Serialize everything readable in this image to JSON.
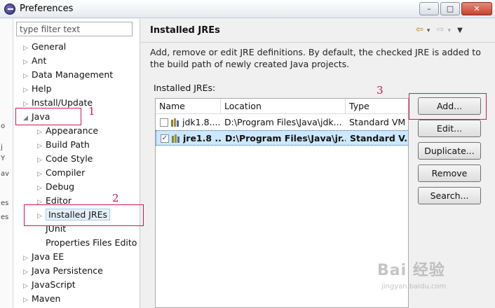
{
  "window": {
    "title": "Preferences",
    "controls": {
      "minimize": "–",
      "maximize": "□",
      "close": "✕"
    }
  },
  "left_edge": {
    "chars": [
      "o",
      "j",
      "Y",
      "av",
      "es",
      "es"
    ]
  },
  "sidebar": {
    "filter_placeholder": "type filter text",
    "items": [
      {
        "label": "General",
        "arrow": "▷"
      },
      {
        "label": "Ant",
        "arrow": "▷"
      },
      {
        "label": "Data Management",
        "arrow": "▷"
      },
      {
        "label": "Help",
        "arrow": "▷"
      },
      {
        "label": "Install/Update",
        "arrow": "▷"
      },
      {
        "label": "Java",
        "arrow": "◢"
      },
      {
        "label": "Appearance",
        "arrow": "▷"
      },
      {
        "label": "Build Path",
        "arrow": "▷"
      },
      {
        "label": "Code Style",
        "arrow": "▷"
      },
      {
        "label": "Compiler",
        "arrow": "▷"
      },
      {
        "label": "Debug",
        "arrow": "▷"
      },
      {
        "label": "Editor",
        "arrow": "▷"
      },
      {
        "label": "Installed JREs",
        "arrow": "▷"
      },
      {
        "label": "JUnit",
        "arrow": ""
      },
      {
        "label": "Properties Files Edito",
        "arrow": ""
      },
      {
        "label": "Java EE",
        "arrow": "▷"
      },
      {
        "label": "Java Persistence",
        "arrow": "▷"
      },
      {
        "label": "JavaScript",
        "arrow": "▷"
      },
      {
        "label": "Maven",
        "arrow": "▷"
      }
    ]
  },
  "main": {
    "title": "Installed JREs",
    "nav": {
      "back": "⇦",
      "back_menu": "▾",
      "forward": "⇨",
      "forward_menu": "▾",
      "view_menu": "▼"
    },
    "description": "Add, remove or edit JRE definitions. By default, the checked JRE is added to the build path of newly created Java projects.",
    "list_label": "Installed JREs:",
    "table": {
      "columns": [
        "Name",
        "Location",
        "Type"
      ],
      "rows": [
        {
          "checked": false,
          "check_mark": "",
          "name": "jdk1.8....",
          "location": "D:\\Program Files\\Java\\jdk...",
          "type": "Standard VM"
        },
        {
          "checked": true,
          "check_mark": "✓",
          "name": "jre1.8 ...",
          "location": "D:\\Program Files\\Java\\jr...",
          "type": "Standard V..."
        }
      ]
    },
    "buttons": {
      "add": "Add...",
      "edit": "Edit...",
      "duplicate": "Duplicate...",
      "remove": "Remove",
      "search": "Search..."
    }
  },
  "annotations": {
    "n1": "1",
    "n2": "2",
    "n3": "3",
    "color": "#d4145a"
  },
  "watermark": {
    "main": "Bai  经验",
    "sub": "jingyan.baidu.com"
  }
}
